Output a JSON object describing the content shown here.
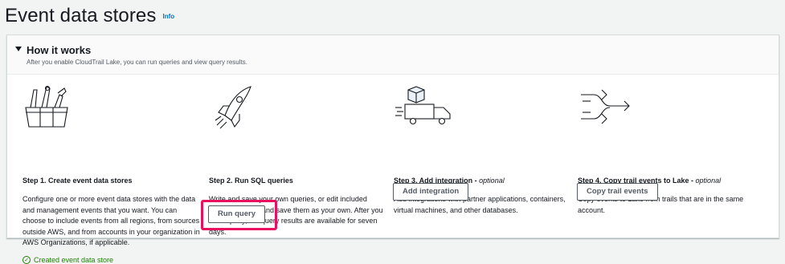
{
  "page": {
    "title": "Event data stores",
    "info_label": "Info"
  },
  "how_it_works": {
    "title": "How it works",
    "description": "After you enable CloudTrail Lake, you can run queries and view query results.",
    "steps": [
      {
        "icon": "toolbox-icon",
        "title": "Step 1. Create event data stores",
        "title_optional": "",
        "description": "Configure one or more event data stores with the data and management events that you want. You can choose to include events from all regions, from sources outside AWS, and from accounts in your organization in AWS Organizations, if applicable.",
        "status": "Created event data store"
      },
      {
        "icon": "rocket-icon",
        "title": "Step 2. Run SQL queries",
        "title_optional": "",
        "description": "Write and save your own queries, or edit included sample queries, and save them as your own. After you run a query, the query results are available for seven days.",
        "button": "Run query"
      },
      {
        "icon": "truck-icon",
        "title": "Step 3. Add integration - ",
        "title_optional": "optional",
        "description": "Add integrations with partner applications, containers, virtual machines, and other databases.",
        "button": "Add integration"
      },
      {
        "icon": "merge-arrows-icon",
        "title": "Step 4. Copy trail events to Lake - ",
        "title_optional": "optional",
        "description": "Copy events to Lake from trails that are in the same account.",
        "button": "Copy trail events"
      }
    ]
  },
  "colors": {
    "accent": "#0073bb",
    "success": "#1d8102",
    "highlight": "#e8115f"
  }
}
